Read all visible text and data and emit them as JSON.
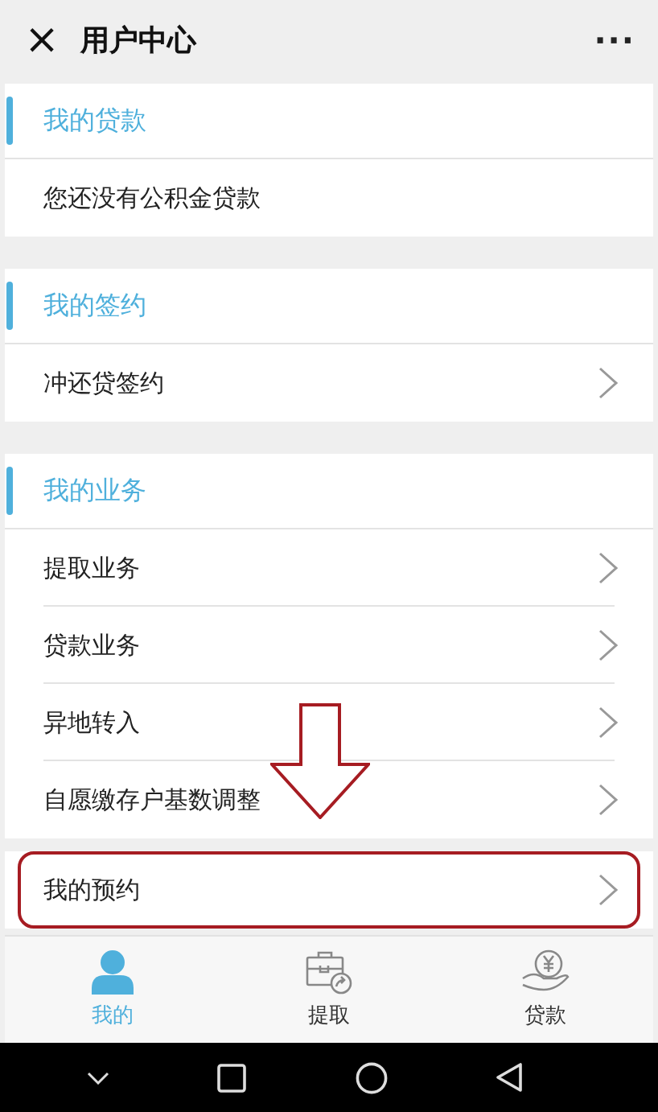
{
  "window": {
    "title": "用户中心",
    "close": "×",
    "menu": "···"
  },
  "sections": [
    {
      "title": "我的贷款",
      "items": [
        {
          "label": "您还没有公积金贷款",
          "kind": "info"
        }
      ]
    },
    {
      "title": "我的签约",
      "items": [
        {
          "label": "冲还贷签约",
          "kind": "link"
        }
      ]
    },
    {
      "title": "我的业务",
      "items": [
        {
          "label": "提取业务",
          "kind": "link"
        },
        {
          "label": "贷款业务",
          "kind": "link"
        },
        {
          "label": "异地转入",
          "kind": "link"
        },
        {
          "label": "自愿缴存户基数调整",
          "kind": "link"
        }
      ]
    }
  ],
  "standalone_row": {
    "label": "我的预约",
    "kind": "link",
    "highlighted": true
  },
  "tabs": [
    {
      "label": "我的",
      "selected": true
    },
    {
      "label": "提取",
      "selected": false
    },
    {
      "label": "贷款",
      "selected": false
    }
  ]
}
